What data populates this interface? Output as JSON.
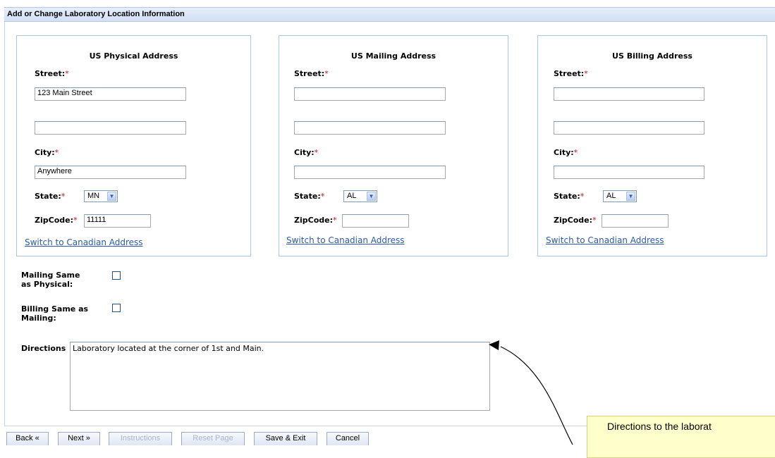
{
  "page": {
    "title": "Add or Change Laboratory Location Information"
  },
  "physical": {
    "title": "US Physical Address",
    "street_label": "Street:",
    "street1": "123 Main Street",
    "street2": "",
    "city_label": "City:",
    "city": "Anywhere",
    "state_label": "State:",
    "state": "MN",
    "zip_label": "ZipCode:",
    "zip": "11111",
    "switch_link": "Switch to Canadian Address"
  },
  "mailing": {
    "title": "US Mailing Address",
    "street_label": "Street:",
    "street1": "",
    "street2": "",
    "city_label": "City:",
    "city": "",
    "state_label": "State:",
    "state": "AL",
    "zip_label": "ZipCode:",
    "zip": "",
    "switch_link": "Switch to Canadian Address"
  },
  "billing": {
    "title": "US Billing Address",
    "street_label": "Street:",
    "street1": "",
    "street2": "",
    "city_label": "City:",
    "city": "",
    "state_label": "State:",
    "state": "AL",
    "zip_label": "ZipCode:",
    "zip": "",
    "switch_link": "Switch to Canadian Address"
  },
  "required_mark": "*",
  "options": {
    "mailing_same": {
      "line1": "Mailing Same",
      "line2": "as Physical:",
      "checked": false
    },
    "billing_same": {
      "line1": "Billing Same as",
      "line2": "Mailing:",
      "checked": false
    }
  },
  "directions": {
    "label": "Directions",
    "value": "Laboratory located at the corner of 1st and Main."
  },
  "buttons": {
    "back": "Back «",
    "next": "Next »",
    "instructions": "Instructions",
    "reset": "Reset Page",
    "save_exit": "Save & Exit",
    "cancel": "Cancel"
  },
  "callout": {
    "text": "Directions to the laborat",
    "bg_color": "#ffffcc"
  },
  "colors": {
    "link": "#2a5aa8",
    "required": "#cc1111",
    "box_border": "#a9c6e3"
  }
}
